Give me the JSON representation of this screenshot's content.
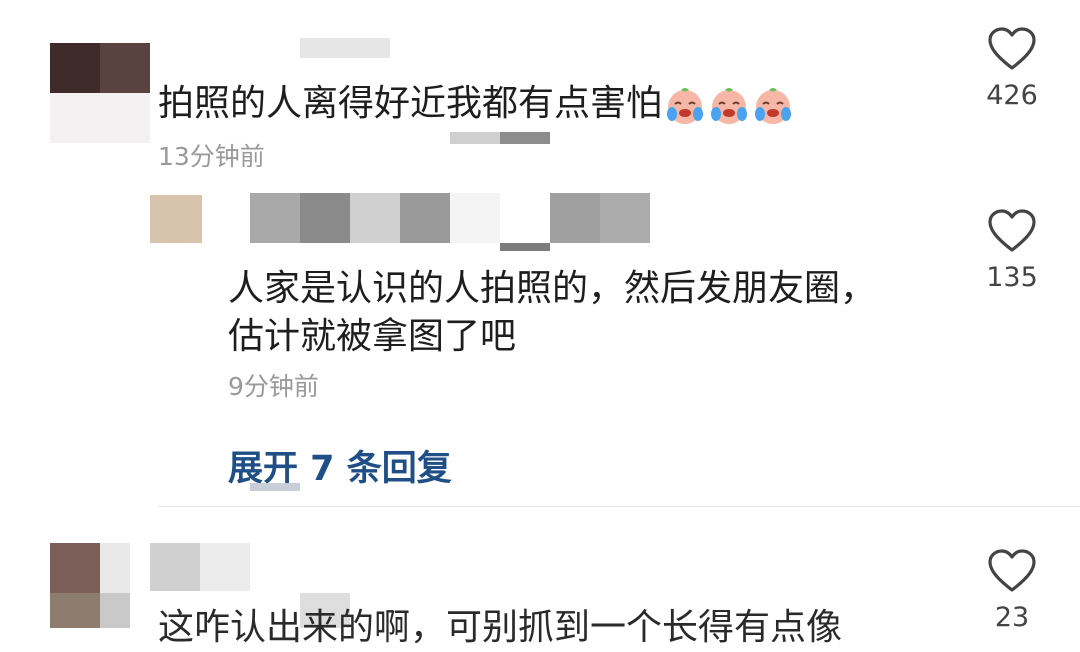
{
  "comments": [
    {
      "text": "拍照的人离得好近我都有点害怕",
      "emoji_icons": [
        "loudly-crying-face-icon",
        "loudly-crying-face-icon",
        "loudly-crying-face-icon"
      ],
      "time": "13分钟前",
      "likes": "426",
      "replies": [
        {
          "text_line1": "人家是认识的人拍照的，然后发朋友圈，",
          "text_line2": "估计就被拿图了吧",
          "time": "9分钟前",
          "likes": "135"
        }
      ],
      "expand_label": "展开 7 条回复"
    },
    {
      "text": "这咋认出来的啊，可别抓到一个长得有点像",
      "likes": "23"
    }
  ],
  "colors": {
    "link": "#1f4f86",
    "time": "#9a9a9a",
    "text": "#1e1e1e"
  }
}
